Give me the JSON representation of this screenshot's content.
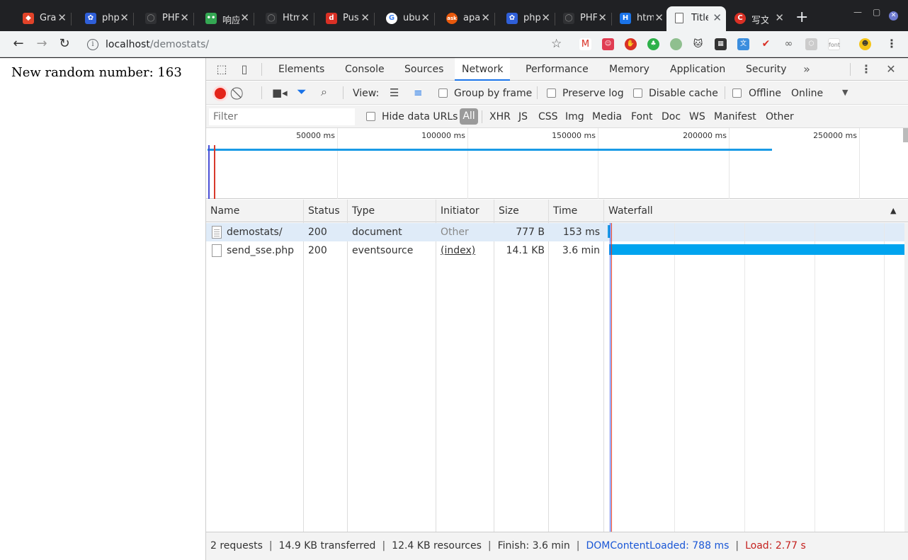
{
  "tabs": [
    {
      "title": "Gra",
      "icon": "gitlab-icon",
      "color": "#e24329"
    },
    {
      "title": "php",
      "icon": "baidu-icon",
      "color": "#2f5fd8"
    },
    {
      "title": "PHF",
      "icon": "github-icon",
      "color": "#555555"
    },
    {
      "title": "响应",
      "icon": "segmentfault-icon",
      "color": "#34a853"
    },
    {
      "title": "Htm",
      "icon": "github-icon",
      "color": "#555555"
    },
    {
      "title": "Pus",
      "icon": "pushbullet-icon",
      "color": "#d93025"
    },
    {
      "title": "ubu",
      "icon": "google-icon",
      "color": "#4285f4"
    },
    {
      "title": "apa",
      "icon": "ask-icon",
      "color": "#e8590c"
    },
    {
      "title": "php",
      "icon": "baidu-icon",
      "color": "#2f5fd8"
    },
    {
      "title": "PHF",
      "icon": "github-icon",
      "color": "#555555"
    },
    {
      "title": "htm",
      "icon": "hostinger-icon",
      "color": "#1a73e8"
    },
    {
      "title": "Title",
      "icon": "document-icon",
      "color": "#ffffff"
    },
    {
      "title": "写文",
      "icon": "csdn-icon",
      "color": "#d93025"
    }
  ],
  "url": {
    "host": "localhost",
    "path": "/demostats/"
  },
  "page": {
    "text": "New random number: 163"
  },
  "devtools": {
    "tabs": [
      "Elements",
      "Console",
      "Sources",
      "Network",
      "Performance",
      "Memory",
      "Application",
      "Security"
    ],
    "active_tab": "Network",
    "toolbar": {
      "view_label": "View:",
      "group_by_frame": "Group by frame",
      "preserve_log": "Preserve log",
      "disable_cache": "Disable cache",
      "offline": "Offline",
      "throttle": "Online"
    },
    "filter": {
      "placeholder": "Filter",
      "hide_data_urls": "Hide data URLs",
      "types": [
        "All",
        "XHR",
        "JS",
        "CSS",
        "Img",
        "Media",
        "Font",
        "Doc",
        "WS",
        "Manifest",
        "Other"
      ]
    },
    "overview": {
      "ticks": [
        "50000 ms",
        "100000 ms",
        "150000 ms",
        "200000 ms",
        "250000 ms"
      ]
    },
    "columns": [
      "Name",
      "Status",
      "Type",
      "Initiator",
      "Size",
      "Time",
      "Waterfall"
    ],
    "requests": [
      {
        "name": "demostats/",
        "status": "200",
        "type": "document",
        "initiator": "Other",
        "size": "777 B",
        "time": "153 ms"
      },
      {
        "name": "send_sse.php",
        "status": "200",
        "type": "eventsource",
        "initiator": "(index)",
        "size": "14.1 KB",
        "time": "3.6 min"
      }
    ],
    "status": {
      "requests": "2 requests",
      "transferred": "14.9 KB transferred",
      "resources": "12.4 KB resources",
      "finish": "Finish: 3.6 min",
      "dom_content_loaded": "DOMContentLoaded: 788 ms",
      "load": "Load: 2.77 s"
    }
  }
}
